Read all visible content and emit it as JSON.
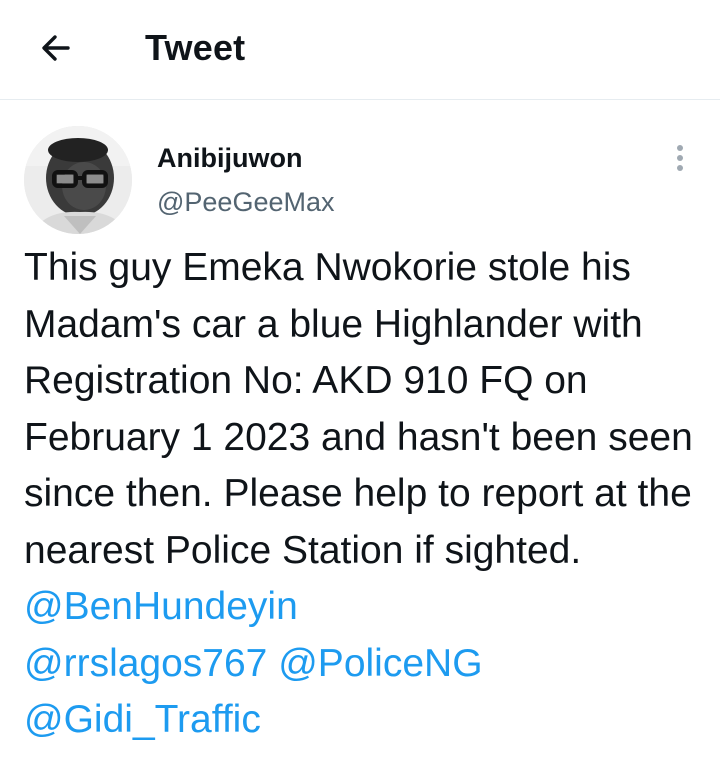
{
  "header": {
    "title": "Tweet",
    "back_icon": "arrow-left-icon"
  },
  "tweet": {
    "author": {
      "display_name": "Anibijuwon",
      "handle": "@PeeGeeMax",
      "avatar": "avatar-photo"
    },
    "more_icon": "more-vertical-icon",
    "text": "This guy Emeka Nwokorie stole his Madam's car a blue Highlander with Registration No: AKD 910 FQ on February 1 2023 and hasn't been seen since then. Please help to report at the nearest Police Station if sighted.",
    "mentions": [
      "@BenHundeyin",
      "@rrslagos767",
      "@PoliceNG",
      "@Gidi_Traffic"
    ]
  },
  "colors": {
    "text": "#0f1419",
    "secondary": "#536471",
    "accent": "#1d9bf0",
    "divider": "#e6ecf0"
  }
}
